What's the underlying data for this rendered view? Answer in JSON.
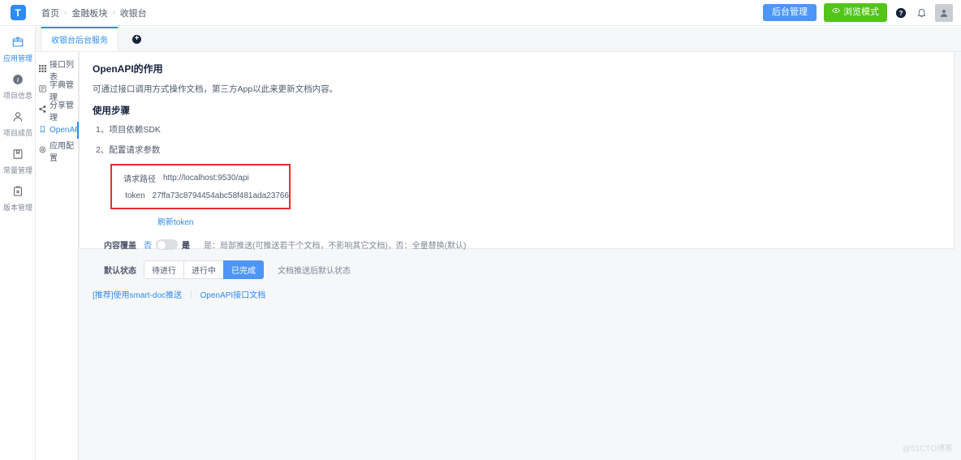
{
  "topbar": {
    "logo_text": "T",
    "breadcrumb": [
      "首页",
      "金融板块",
      "收银台"
    ],
    "admin_button": "后台管理",
    "browse_button": "浏览模式",
    "help_icon": "question-circle-icon",
    "bell_icon": "bell-icon",
    "avatar_icon": "user-avatar-icon"
  },
  "rail": {
    "items": [
      {
        "label": "应用管理",
        "icon": "app-box-icon",
        "active": true
      },
      {
        "label": "项目信息",
        "icon": "info-circle-icon",
        "active": false
      },
      {
        "label": "项目成员",
        "icon": "user-icon",
        "active": false
      },
      {
        "label": "常量管理",
        "icon": "book-icon",
        "active": false
      },
      {
        "label": "版本管理",
        "icon": "clipboard-icon",
        "active": false
      }
    ]
  },
  "subnav": {
    "items": [
      {
        "label": "接口列表",
        "icon": "grid-icon",
        "active": false
      },
      {
        "label": "字典管理",
        "icon": "dictionary-icon",
        "active": false
      },
      {
        "label": "分享管理",
        "icon": "share-icon",
        "active": false
      },
      {
        "label": "OpenAPI",
        "icon": "bookmark-icon",
        "active": true
      },
      {
        "label": "应用配置",
        "icon": "settings-gear-icon",
        "active": false
      }
    ]
  },
  "tabs": {
    "items": [
      {
        "label": "收银台后台服务",
        "active": true
      }
    ],
    "add_label": "+"
  },
  "content": {
    "section_title": "OpenAPI的作用",
    "section_desc": "可通过接口调用方式操作文档，第三方App以此来更新文档内容。",
    "steps_title": "使用步骤",
    "steps": [
      "1、项目依赖SDK",
      "2、配置请求参数"
    ],
    "fields": [
      {
        "label": "请求路径",
        "value": "http://localhost:9530/api"
      },
      {
        "label": "token",
        "value": "27ffa73c8794454abc58f481ada23766"
      }
    ],
    "refresh_token": "刷新token",
    "override": {
      "label": "内容覆盖",
      "off_text": "否",
      "on_text": "是",
      "value": "否",
      "hint": "是：局部推送(可推送若干个文档，不影响其它文档)，否：全量替换(默认)"
    },
    "default_status": {
      "label": "默认状态",
      "options": [
        "待进行",
        "进行中",
        "已完成"
      ],
      "selected": "已完成",
      "hint": "文档推送后默认状态"
    },
    "footer_links": [
      {
        "text": "[推荐]使用smart-doc推送"
      },
      {
        "text": "OpenAPI接口文档"
      }
    ],
    "link_separator": "|"
  },
  "watermark": "@51CTO博客",
  "colors": {
    "primary": "#2d8cf0",
    "admin_blue": "#4d96f7",
    "browse_green": "#52c41a",
    "red_border": "#ee2b2b"
  }
}
